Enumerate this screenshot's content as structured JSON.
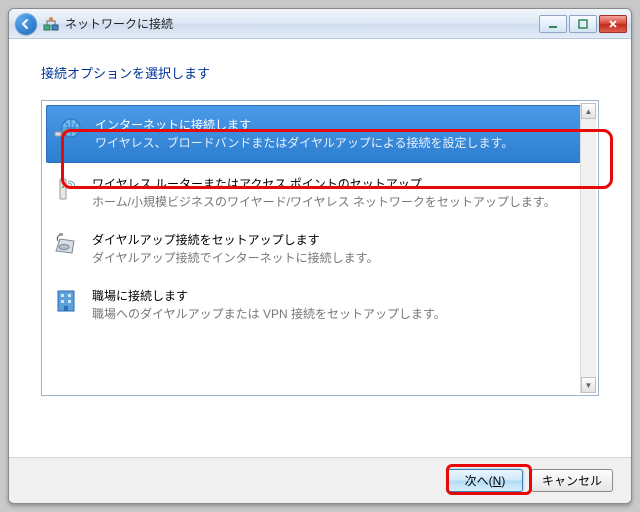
{
  "window": {
    "title": "ネットワークに接続"
  },
  "instruction": "接続オプションを選択します",
  "options": [
    {
      "title": "インターネットに接続します",
      "desc": "ワイヤレス、ブロードバンドまたはダイヤルアップによる接続を設定します。"
    },
    {
      "title": "ワイヤレス ルーターまたはアクセス ポイントのセットアップ",
      "desc": "ホーム/小規模ビジネスのワイヤード/ワイヤレス ネットワークをセットアップします。"
    },
    {
      "title": "ダイヤルアップ接続をセットアップします",
      "desc": "ダイヤルアップ接続でインターネットに接続します。"
    },
    {
      "title": "職場に接続します",
      "desc": "職場へのダイヤルアップまたは VPN 接続をセットアップします。"
    }
  ],
  "buttons": {
    "next": "次へ(N)",
    "cancel": "キャンセル"
  }
}
